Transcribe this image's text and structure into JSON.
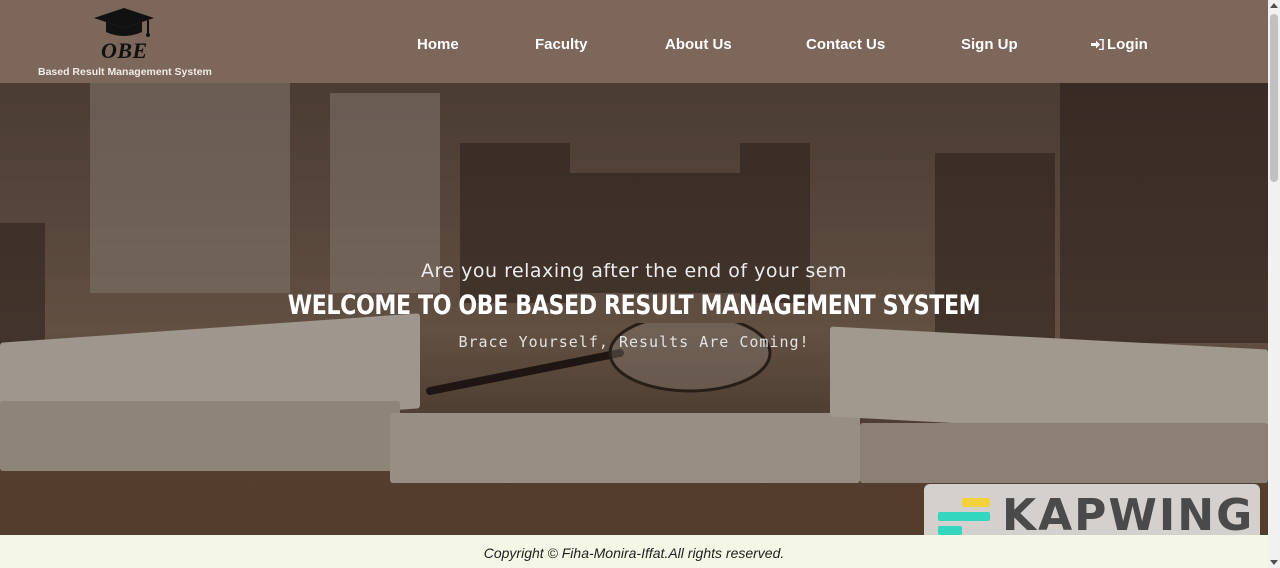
{
  "header": {
    "logo_text": "OBE",
    "tagline": "Based Result Management System",
    "background_color": "#7d665a"
  },
  "nav": {
    "items": [
      {
        "label": "Home"
      },
      {
        "label": "Faculty"
      },
      {
        "label": "About Us"
      },
      {
        "label": "Contact Us"
      },
      {
        "label": "Sign Up"
      },
      {
        "label": "Login",
        "icon": "login-icon"
      }
    ]
  },
  "hero": {
    "subtitle_top": "Are you relaxing after the end of your sem",
    "title": "WELCOME TO OBE BASED RESULT MANAGEMENT SYSTEM",
    "subtitle_bottom": "Brace Yourself, Results Are Coming!"
  },
  "watermark": {
    "text": "KAPWING"
  },
  "footer": {
    "copyright": "Copyright © Fiha-Monira-Iffat.All rights reserved."
  }
}
